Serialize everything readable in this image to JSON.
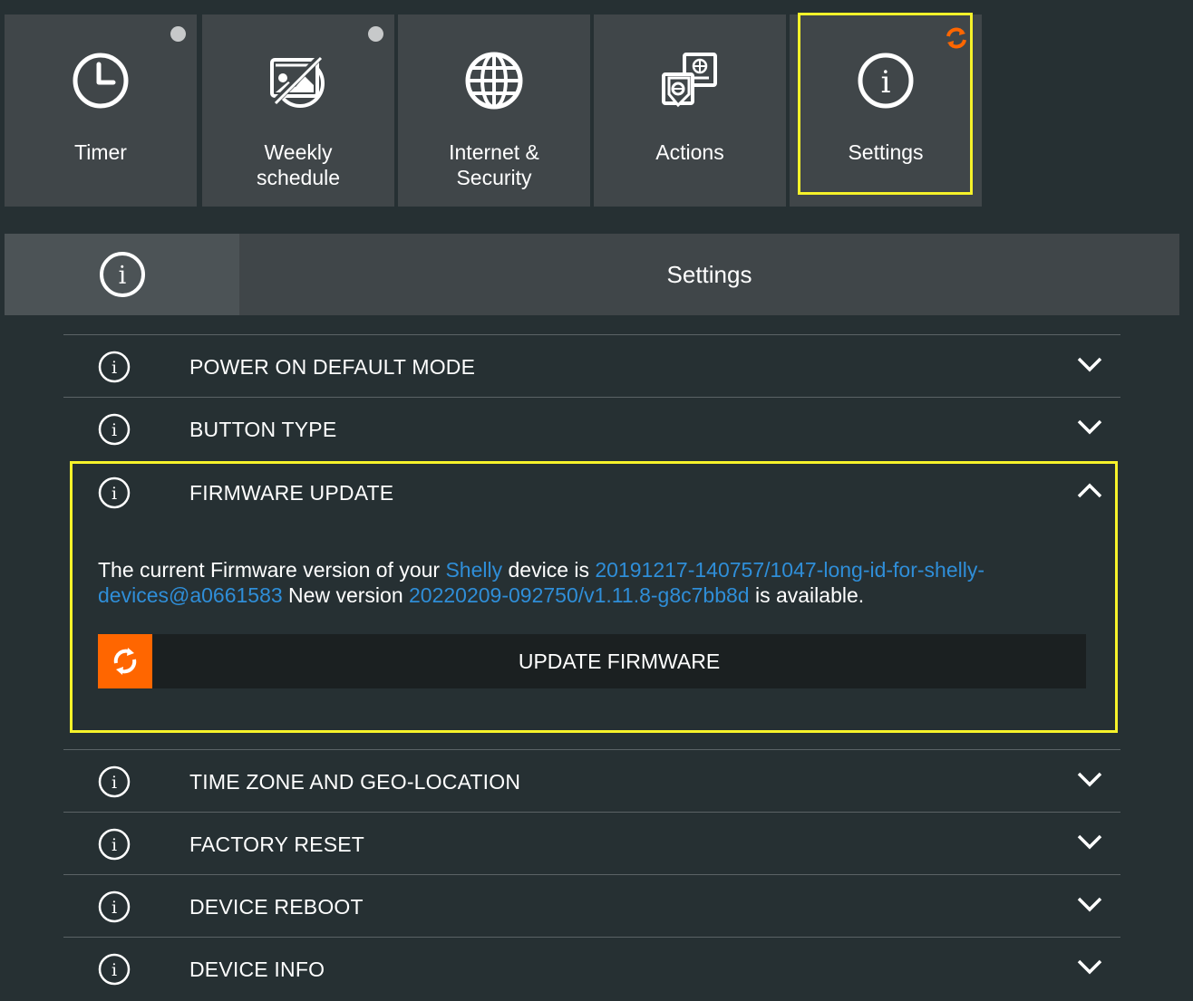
{
  "tiles": [
    {
      "label": "Timer",
      "icon": "clock-icon",
      "indicator": "dot"
    },
    {
      "label": "Weekly\nschedule",
      "icon": "schedule-icon",
      "indicator": "dot"
    },
    {
      "label": "Internet &\nSecurity",
      "icon": "globe-icon"
    },
    {
      "label": "Actions",
      "icon": "actions-icon"
    },
    {
      "label": "Settings",
      "icon": "info-icon",
      "indicator": "sync",
      "active": true
    }
  ],
  "header": {
    "title": "Settings",
    "icon": "info-icon"
  },
  "sections": [
    {
      "label": "POWER ON DEFAULT MODE"
    },
    {
      "label": "BUTTON TYPE"
    },
    {
      "label": "FIRMWARE UPDATE",
      "expanded": true
    },
    {
      "label": "TIME ZONE AND GEO-LOCATION"
    },
    {
      "label": "FACTORY RESET"
    },
    {
      "label": "DEVICE REBOOT"
    },
    {
      "label": "DEVICE INFO"
    }
  ],
  "firmware": {
    "text_1": "The current Firmware version of your ",
    "brand": "Shelly",
    "text_2": " device is ",
    "current_version": "20191217-140757/1047-long-id-for-shelly-devices@a0661583",
    "text_3": " New version ",
    "new_version": "20220209-092750/v1.11.8-g8c7bb8d",
    "text_4": " is available.",
    "button_label": "UPDATE FIRMWARE"
  },
  "colors": {
    "background": "#263033",
    "tile": "#404649",
    "highlight": "#f6f22a",
    "accent": "#ff6600",
    "link": "#2f8ed8"
  }
}
